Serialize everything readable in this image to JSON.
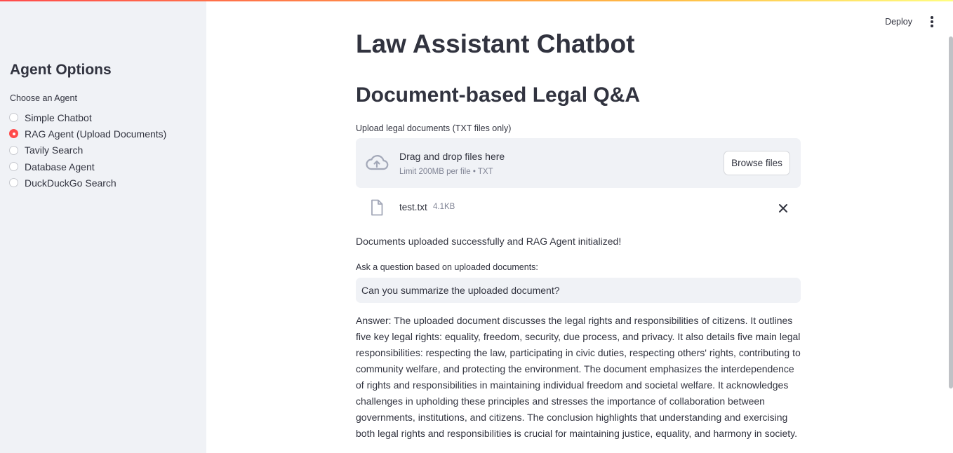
{
  "sidebar": {
    "title": "Agent Options",
    "radio_label": "Choose an Agent",
    "options": [
      {
        "label": "Simple Chatbot",
        "selected": false
      },
      {
        "label": "RAG Agent (Upload Documents)",
        "selected": true
      },
      {
        "label": "Tavily Search",
        "selected": false
      },
      {
        "label": "Database Agent",
        "selected": false
      },
      {
        "label": "DuckDuckGo Search",
        "selected": false
      }
    ]
  },
  "header": {
    "deploy_label": "Deploy",
    "menu_icon": "kebab-menu-icon"
  },
  "main": {
    "title": "Law Assistant Chatbot",
    "subtitle": "Document-based Legal Q&A",
    "uploader": {
      "label": "Upload legal documents (TXT files only)",
      "drop_title": "Drag and drop files here",
      "drop_sub": "Limit 200MB per file • TXT",
      "browse_label": "Browse files",
      "icon": "cloud-upload-icon"
    },
    "file": {
      "name": "test.txt",
      "size": "4.1KB",
      "icon": "file-icon",
      "remove_icon": "close-icon"
    },
    "success_message": "Documents uploaded successfully and RAG Agent initialized!",
    "question": {
      "label": "Ask a question based on uploaded documents:",
      "value": "Can you summarize the uploaded document?"
    },
    "answer": "Answer: The uploaded document discusses the legal rights and responsibilities of citizens. It outlines five key legal rights: equality, freedom, security, due process, and privacy. It also details five main legal responsibilities: respecting the law, participating in civic duties, respecting others' rights, contributing to community welfare, and protecting the environment. The document emphasizes the interdependence of rights and responsibilities in maintaining individual freedom and societal welfare. It acknowledges challenges in upholding these principles and stresses the importance of collaboration between governments, institutions, and citizens. The conclusion highlights that understanding and exercising both legal rights and responsibilities is crucial for maintaining justice, equality, and harmony in society."
  },
  "colors": {
    "accent": "#ff4b4b",
    "sidebar_bg": "#f0f2f6",
    "text": "#31333f",
    "muted": "#808495"
  }
}
